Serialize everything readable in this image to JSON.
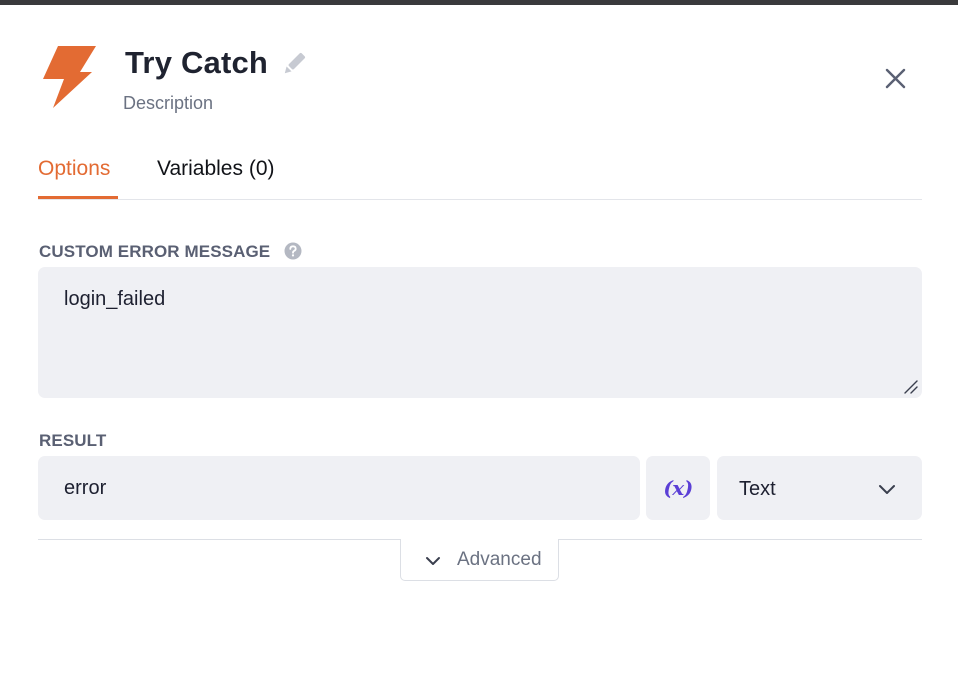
{
  "header": {
    "title": "Try Catch",
    "description": "Description",
    "logo_icon": "lightning-bolt-icon",
    "edit_icon": "pencil-icon",
    "close_icon": "close-icon",
    "accent_color": "#e36b33"
  },
  "tabs": [
    {
      "label": "Options",
      "active": true
    },
    {
      "label": "Variables (0)",
      "active": false
    }
  ],
  "form": {
    "custom_error": {
      "label": "CUSTOM ERROR MESSAGE",
      "help_icon": "question-circle-icon",
      "value": "login_failed"
    },
    "result": {
      "label": "RESULT",
      "value": "error",
      "variable_button": "(x)",
      "type_select": {
        "value": "Text",
        "icon": "chevron-down-icon"
      }
    }
  },
  "advanced": {
    "label": "Advanced",
    "icon": "chevron-down-icon"
  }
}
